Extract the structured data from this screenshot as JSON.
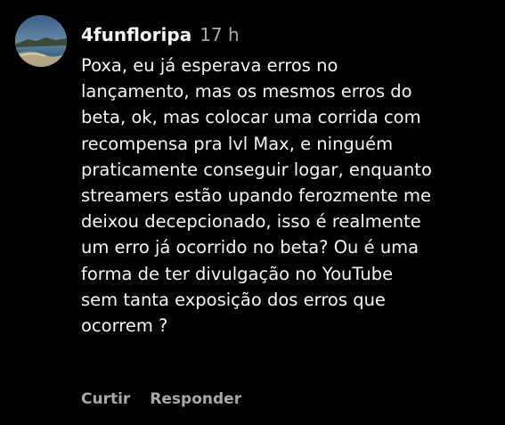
{
  "comment": {
    "avatar_icon": "profile-avatar-photo",
    "username": "4funfloripa",
    "time": "17 h",
    "body_lines": [
      "Poxa, eu já esperava erros no",
      "lançamento, mas os mesmos erros do",
      "beta, ok, mas colocar uma corrida com",
      "recompensa pra lvl Max, e ninguém",
      "praticamente conseguir logar, enquanto",
      "streamers estão upando ferozmente me",
      "deixou decepcionado, isso é realmente",
      "um erro já ocorrido no beta? Ou é uma",
      "forma de ter divulgação no YouTube",
      "sem tanta exposição dos erros que",
      "ocorrem ?"
    ],
    "actions": {
      "like_label": "Curtir",
      "reply_label": "Responder"
    }
  },
  "colors": {
    "background": "#000000",
    "primary_text": "#f5f5f5",
    "secondary_text": "#a8a8a8"
  }
}
